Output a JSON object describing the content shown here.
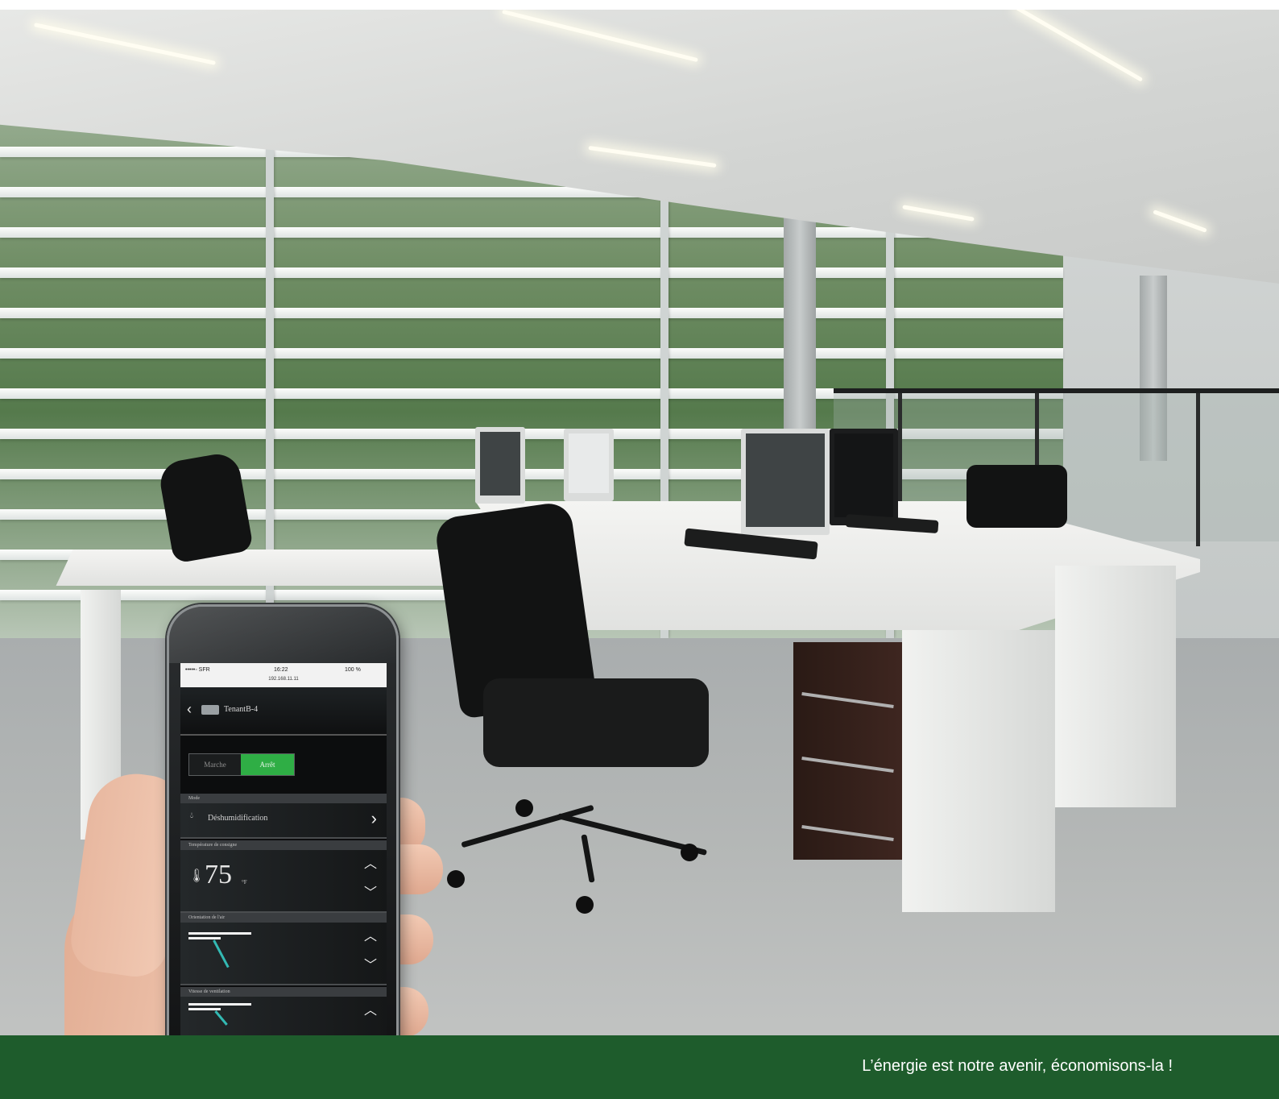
{
  "phone": {
    "status": {
      "carrier": "•••••◦ SFR",
      "time": "16:22",
      "battery": "100 %",
      "url": "192.168.11.11"
    },
    "header": {
      "title": "TenantB-4"
    },
    "toggle": {
      "on_label": "Marche",
      "off_label": "Arrêt",
      "selected": "Arrêt"
    },
    "sections": {
      "mode_label": "Mode",
      "mode_value": "Déshumidification",
      "setpoint_label": "Température de consigne",
      "setpoint_value": "75",
      "setpoint_unit": "°F",
      "orientation_label": "Orientation de l'air",
      "speed_label": "Vitesse de ventilation"
    }
  },
  "banner": {
    "tagline": "L’énergie est notre avenir, économisons-la !"
  },
  "colors": {
    "banner_green": "#1e5c2c",
    "toggle_green": "#2fae45",
    "needle_teal": "#33b9b3"
  },
  "icons": [
    "back-chevron-icon",
    "device-icon",
    "drop-icon",
    "thermometer-icon",
    "chevron-right-icon",
    "chevron-up-icon",
    "chevron-down-icon"
  ]
}
